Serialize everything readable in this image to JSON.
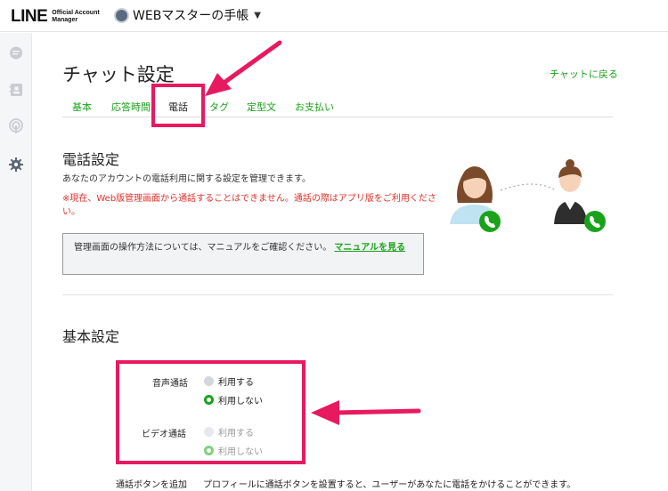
{
  "header": {
    "logo_main": "LINE",
    "logo_sub_line1": "Official Account",
    "logo_sub_line2": "Manager",
    "account_name": "WEBマスターの手帳"
  },
  "sidebar": {
    "items": [
      {
        "icon": "chat-bubble-icon"
      },
      {
        "icon": "contacts-icon"
      },
      {
        "icon": "broadcast-icon"
      },
      {
        "icon": "gear-icon"
      }
    ]
  },
  "page": {
    "title": "チャット設定",
    "back_link": "チャットに戻る"
  },
  "tabs": [
    {
      "label": "基本",
      "active": false
    },
    {
      "label": "応答時間",
      "active": false
    },
    {
      "label": "電話",
      "active": true
    },
    {
      "label": "タグ",
      "active": false
    },
    {
      "label": "定型文",
      "active": false
    },
    {
      "label": "お支払い",
      "active": false
    }
  ],
  "phone_section": {
    "title": "電話設定",
    "description": "あなたのアカウントの電話利用に関する設定を管理できます。",
    "warning": "※現在、Web版管理画面から通話することはできません。通話の際はアプリ版をご利用ください。",
    "notice_text": "管理画面の操作方法については、マニュアルをご確認ください。",
    "notice_link": "マニュアルを見る"
  },
  "basic_section": {
    "title": "基本設定",
    "voice": {
      "label": "音声通話",
      "options": [
        "利用する",
        "利用しない"
      ],
      "selected": "利用しない"
    },
    "video": {
      "label": "ビデオ通話",
      "options": [
        "利用する",
        "利用しない"
      ],
      "selected": "利用しない"
    },
    "call_button": {
      "label": "通話ボタンを追加",
      "description": "プロフィールに通話ボタンを設置すると、ユーザーがあなたに電話をかけることができます。"
    }
  },
  "colors": {
    "accent_green": "#1aa31a",
    "warning_red": "#e0302a",
    "highlight_pink": "#e8195f"
  }
}
